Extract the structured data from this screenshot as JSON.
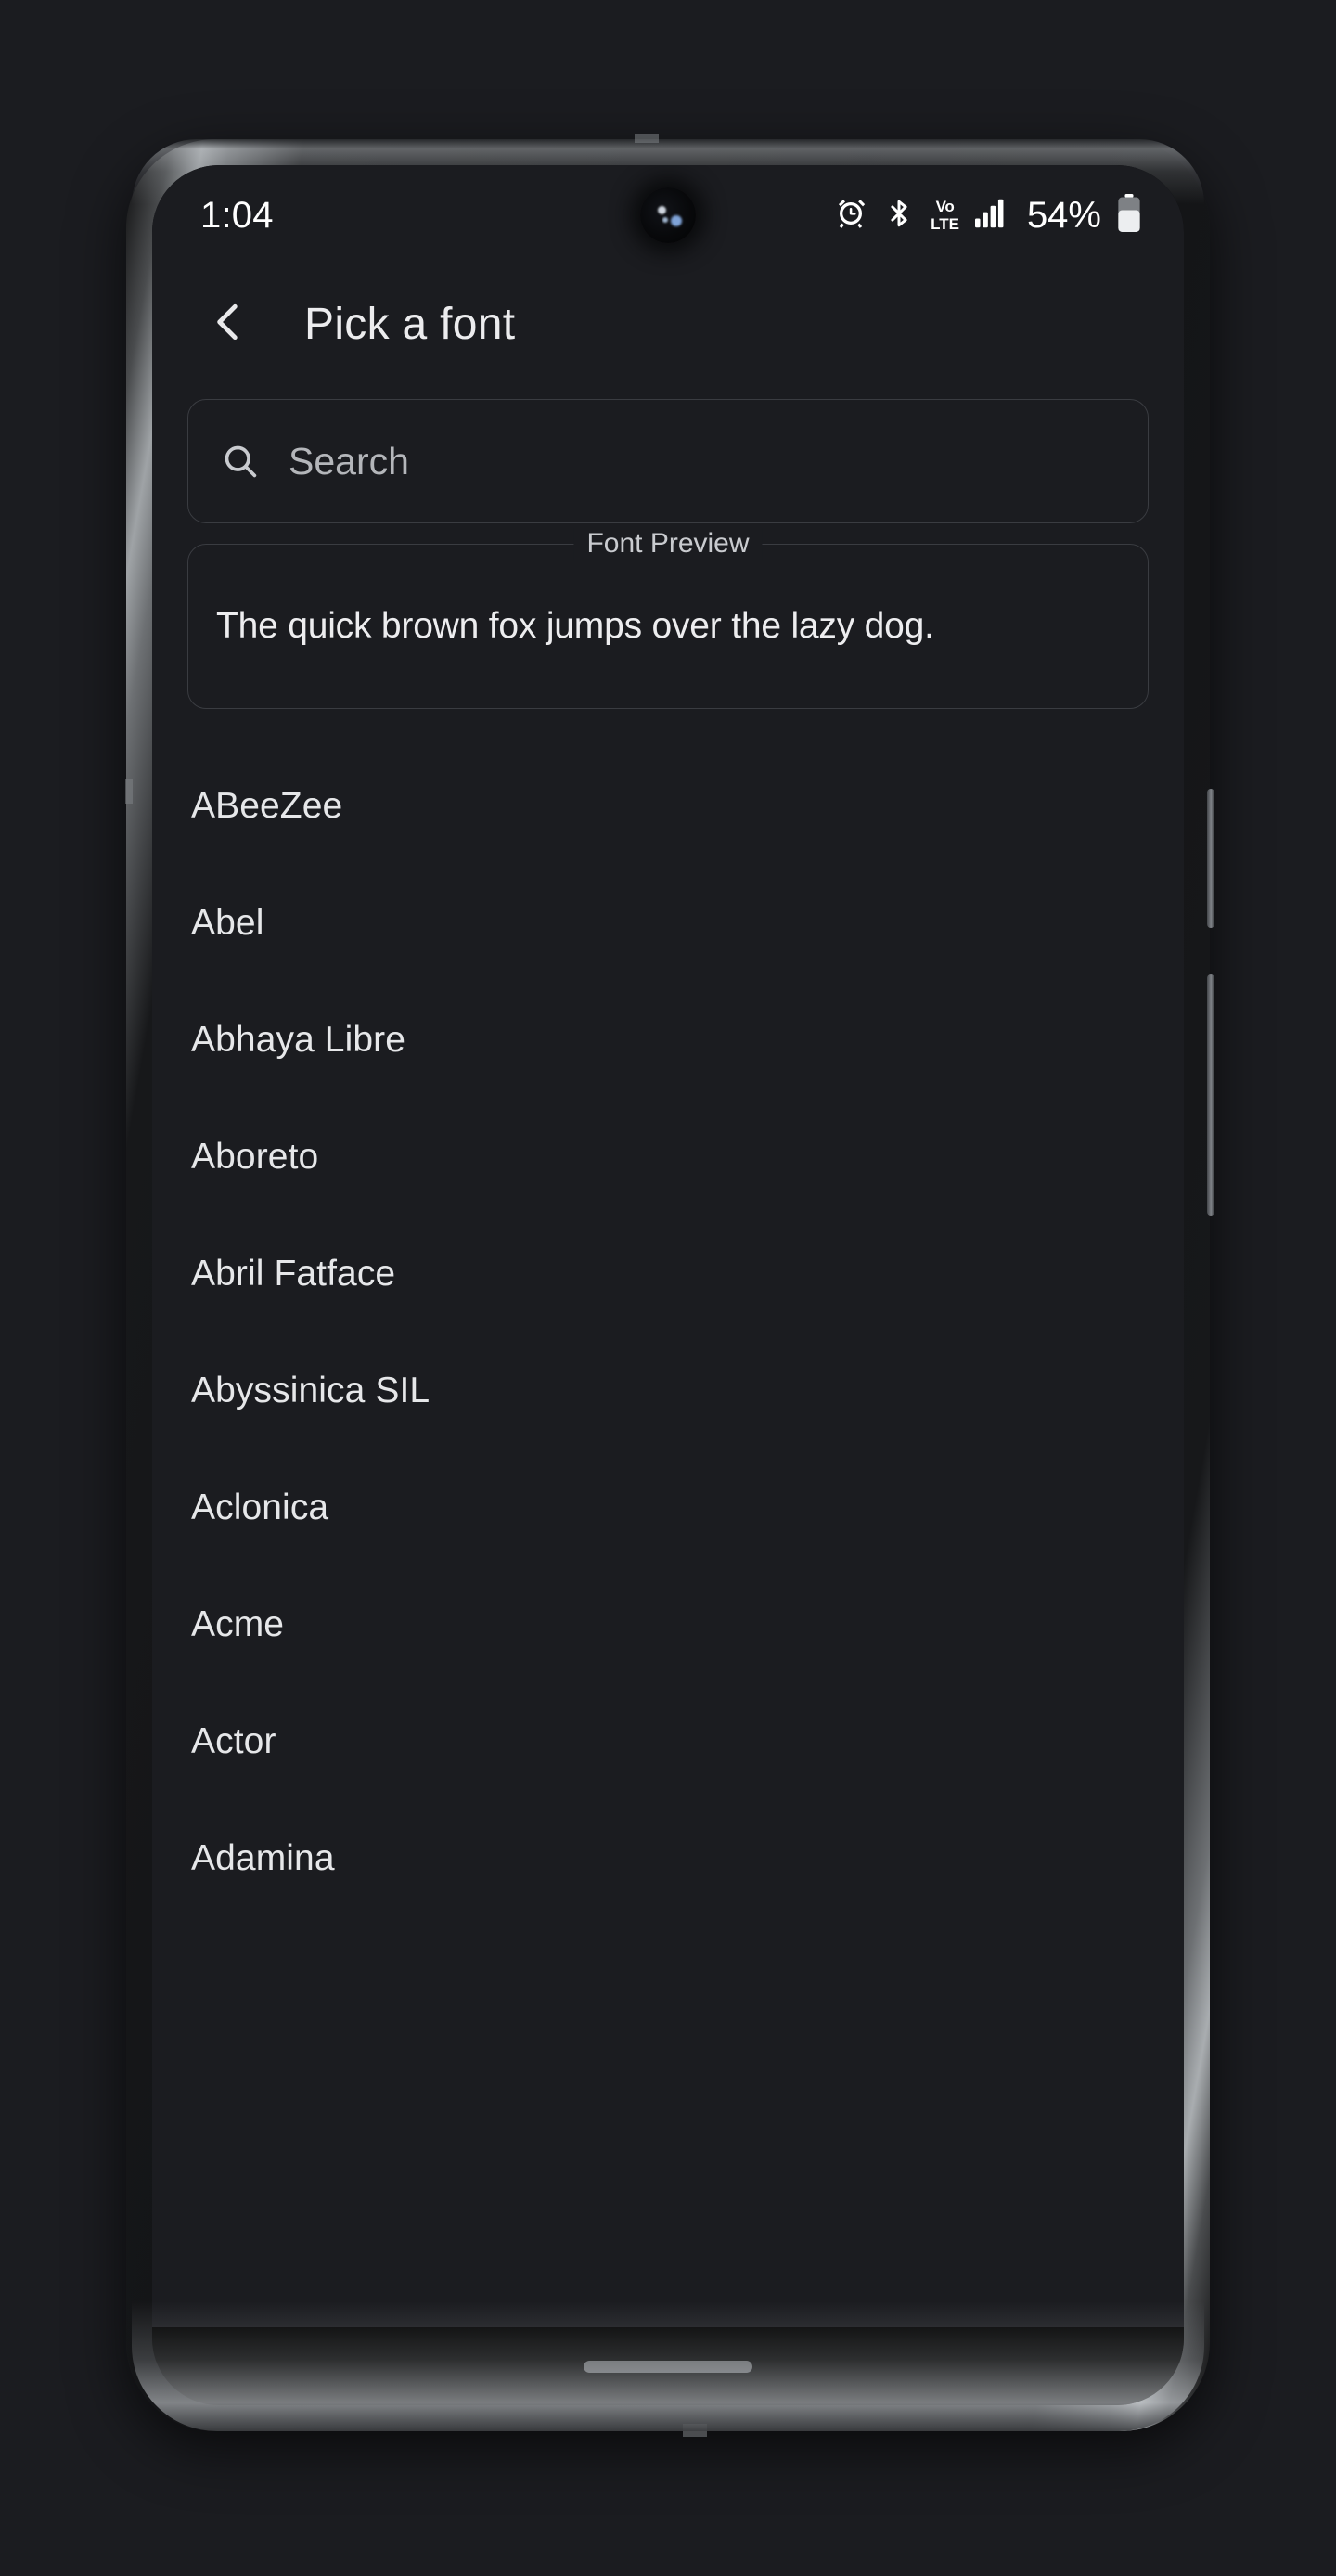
{
  "status_bar": {
    "time": "1:04",
    "battery_percent": "54%",
    "icons": [
      "alarm-icon",
      "bluetooth-icon",
      "volte-icon",
      "signal-icon",
      "battery-icon"
    ],
    "volte_top": "Vo",
    "volte_bottom": "LTE"
  },
  "app_bar": {
    "back_icon": "chevron-left-icon",
    "title": "Pick a font"
  },
  "search": {
    "icon": "search-icon",
    "placeholder": "Search",
    "value": ""
  },
  "preview": {
    "legend": "Font Preview",
    "text": "The quick brown fox jumps over the lazy dog."
  },
  "font_list": {
    "items": [
      {
        "name": "ABeeZee"
      },
      {
        "name": "Abel"
      },
      {
        "name": "Abhaya Libre"
      },
      {
        "name": "Aboreto"
      },
      {
        "name": "Abril Fatface"
      },
      {
        "name": "Abyssinica SIL"
      },
      {
        "name": "Aclonica"
      },
      {
        "name": "Acme"
      },
      {
        "name": "Actor"
      },
      {
        "name": "Adamina"
      }
    ]
  },
  "nav_bar": {
    "gesture_pill": "home-gesture-pill"
  },
  "colors": {
    "app_background": "#1b1c20",
    "text_primary": "#e6e7e9",
    "text_secondary": "#b4b6ba",
    "outline": "#3a3c41",
    "nav_background": "#000000"
  }
}
